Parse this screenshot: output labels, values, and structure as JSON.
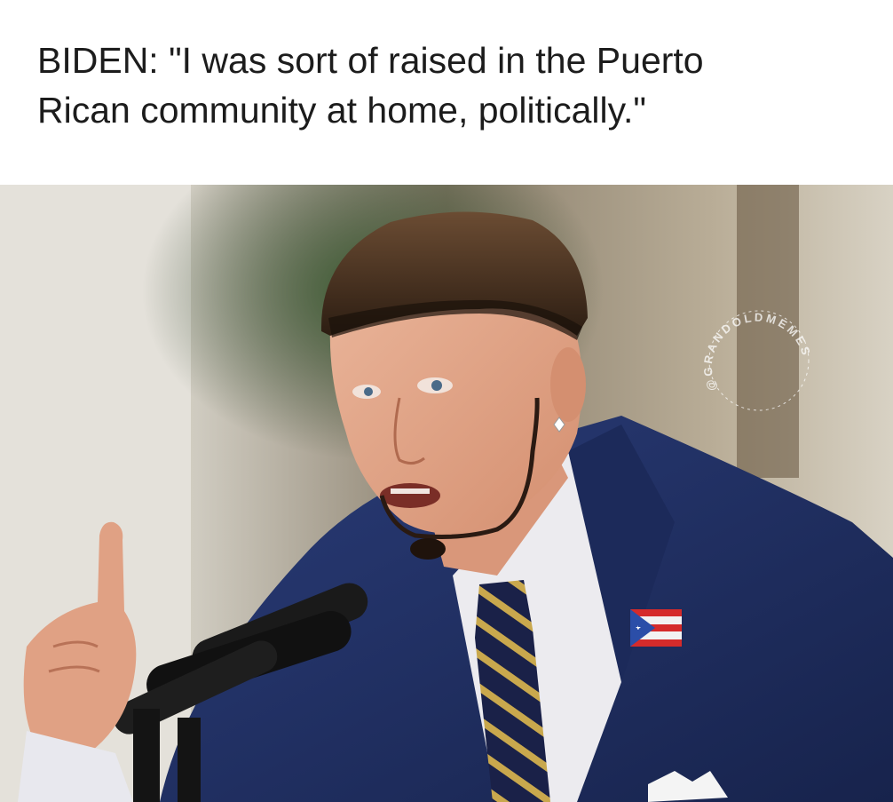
{
  "caption": {
    "text": "BIDEN: \"I was sort of raised in the Puerto\nRican community at home, politically.\""
  },
  "photo": {
    "watermark_text": "@GRANDOLDMEMES",
    "subject": "man with bowl haircut and goatee speaking at microphones, wearing navy suit with flag pin",
    "colors": {
      "background_wall": "#d9d6cd",
      "foliage": "#2f4a2a",
      "suit": "#1f2f63",
      "shirt": "#ecebef",
      "hair": "#4a3322",
      "skin": "#e3a688",
      "tie_navy": "#1a2148",
      "tie_gold": "#c9a84d",
      "flag_red": "#d52b2b",
      "flag_blue": "#2b4ea8"
    }
  }
}
